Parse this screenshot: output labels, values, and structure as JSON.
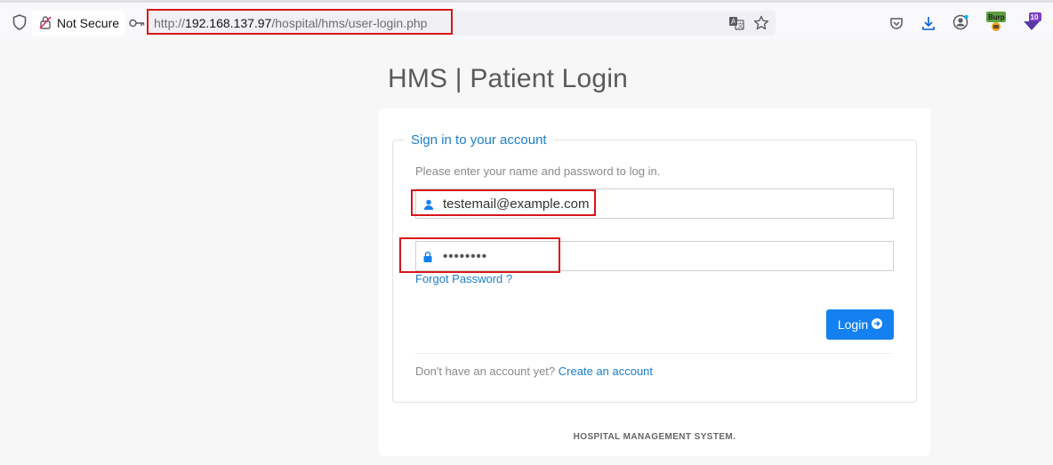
{
  "browser": {
    "security_label": "Not Secure",
    "url_prefix": "http://",
    "url_host": "192.168.137.97",
    "url_path": "/hospital/hms/user-login.php",
    "extension_badge_text": "Burp",
    "notification_count": "10",
    "icons": [
      "shield-icon",
      "insecure-lock-icon",
      "key-icon",
      "translate-icon",
      "star-icon",
      "pocket-icon",
      "download-icon",
      "account-icon",
      "burp-extension-icon",
      "extension-notification-icon"
    ]
  },
  "page": {
    "title": "HMS | Patient Login",
    "legend": "Sign in to your account",
    "help_text": "Please enter your name and password to log in.",
    "email_value": "testemail@example.com",
    "password_value": "••••••••",
    "forgot_link": "Forgot Password ?",
    "login_button": "Login",
    "signup_prompt": "Don't have an account yet?",
    "signup_link": "Create an account",
    "footer": "HOSPITAL MANAGEMENT SYSTEM."
  },
  "colors": {
    "accent": "#1580ef",
    "link": "#1b7ecb",
    "highlight_box": "#d9161b"
  }
}
